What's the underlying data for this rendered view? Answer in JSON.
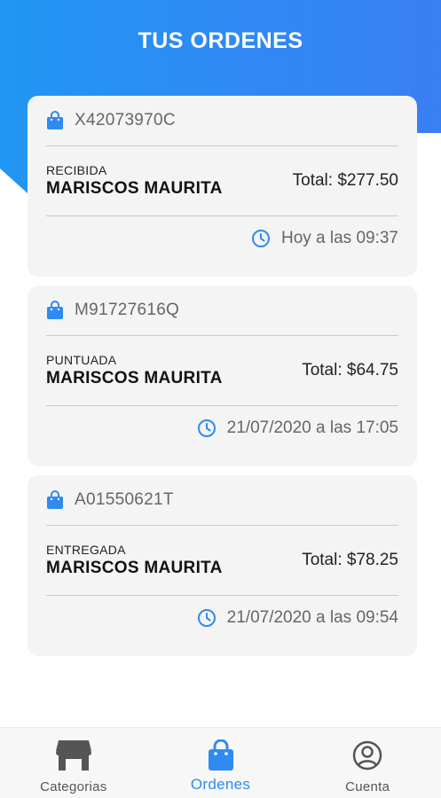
{
  "header": {
    "title": "TUS ORDENES"
  },
  "colors": {
    "accent": "#2f8bf0",
    "gradient_start": "#2196f3",
    "gradient_end": "#3b7ff5",
    "divider": "#a9d3f3"
  },
  "orders": [
    {
      "code": "X42073970C",
      "status": "RECIBIDA",
      "store": "MARISCOS MAURITA",
      "total": "Total: $277.50",
      "time": "Hoy a las 09:37"
    },
    {
      "code": "M91727616Q",
      "status": "PUNTUADA",
      "store": "MARISCOS MAURITA",
      "total": "Total: $64.75",
      "time": "21/07/2020 a las 17:05"
    },
    {
      "code": "A01550621T",
      "status": "ENTREGADA",
      "store": "MARISCOS MAURITA",
      "total": "Total: $78.25",
      "time": "21/07/2020 a las 09:54"
    }
  ],
  "nav": {
    "items": [
      {
        "label": "Categorias",
        "icon": "store-icon",
        "active": false
      },
      {
        "label": "Ordenes",
        "icon": "shopping-bag-icon",
        "active": true
      },
      {
        "label": "Cuenta",
        "icon": "user-circle-icon",
        "active": false
      }
    ]
  }
}
